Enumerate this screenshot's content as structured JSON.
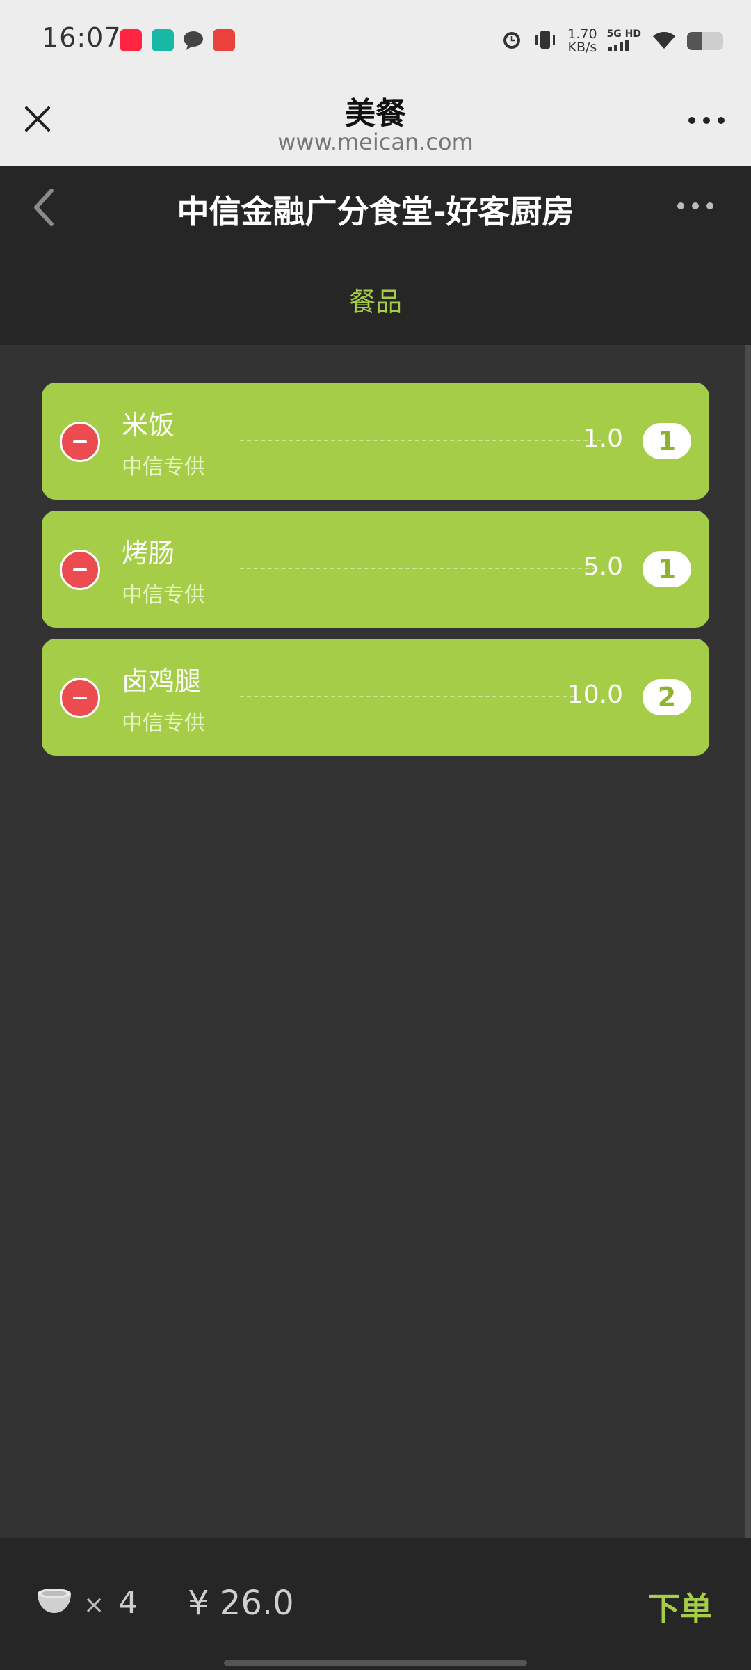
{
  "status_bar": {
    "time": "16:07",
    "net_speed_value": "1.70",
    "net_speed_unit": "KB/s",
    "network": "5G HD",
    "battery_level": 0.4,
    "icons": [
      "xiaohongshu-app-icon",
      "app-icon",
      "message-icon",
      "shop-app-icon",
      "alarm-icon",
      "vibrate-icon",
      "signal-icon",
      "wifi-icon",
      "battery-icon"
    ]
  },
  "title_bar": {
    "title": "美餐",
    "url": "www.meican.com"
  },
  "page_header": {
    "title": "中信金融广分食堂-好客厨房",
    "tab": "餐品"
  },
  "order_items": [
    {
      "name": "米饭",
      "subtitle": "中信专供",
      "price": "1.0",
      "quantity": "1"
    },
    {
      "name": "烤肠",
      "subtitle": "中信专供",
      "price": "5.0",
      "quantity": "1"
    },
    {
      "name": "卤鸡腿",
      "subtitle": "中信专供",
      "price": "10.0",
      "quantity": "2"
    }
  ],
  "bottom_bar": {
    "times": "×",
    "count": "4",
    "total": "¥ 26.0",
    "order_label": "下单"
  },
  "colors": {
    "accent_green": "#a5cd47",
    "remove_red": "#ec4b4f",
    "header_dark": "#262626",
    "background": "#333333"
  }
}
